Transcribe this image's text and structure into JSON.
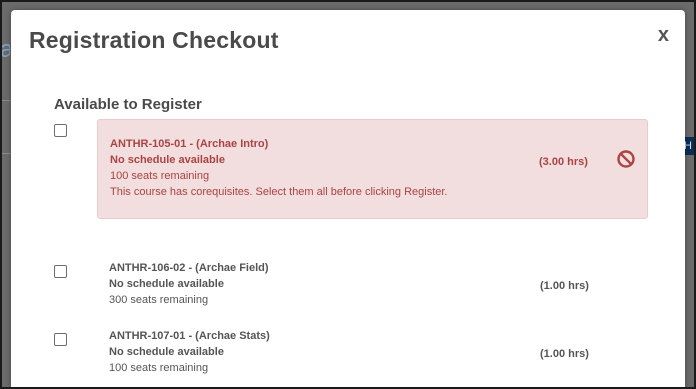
{
  "modal": {
    "title": "Registration Checkout",
    "close_label": "x",
    "section_title": "Available to Register"
  },
  "courses": [
    {
      "code": "ANTHR-105-01 - (Archae Intro)",
      "schedule": "No schedule available",
      "seats": "100 seats remaining",
      "note": "This course has corequisites. Select them all before clicking Register.",
      "hours": "(3.00 hrs)",
      "status": "blocked",
      "status_icon": "ban-icon",
      "status_color": "#a94442"
    },
    {
      "code": "ANTHR-106-02 - (Archae Field)",
      "schedule": "No schedule available",
      "seats": "300 seats remaining",
      "hours": "(1.00 hrs)"
    },
    {
      "code": "ANTHR-107-01 - (Archae Stats)",
      "schedule": "No schedule available",
      "seats": "100 seats remaining",
      "hours": "(1.00 hrs)"
    }
  ]
}
